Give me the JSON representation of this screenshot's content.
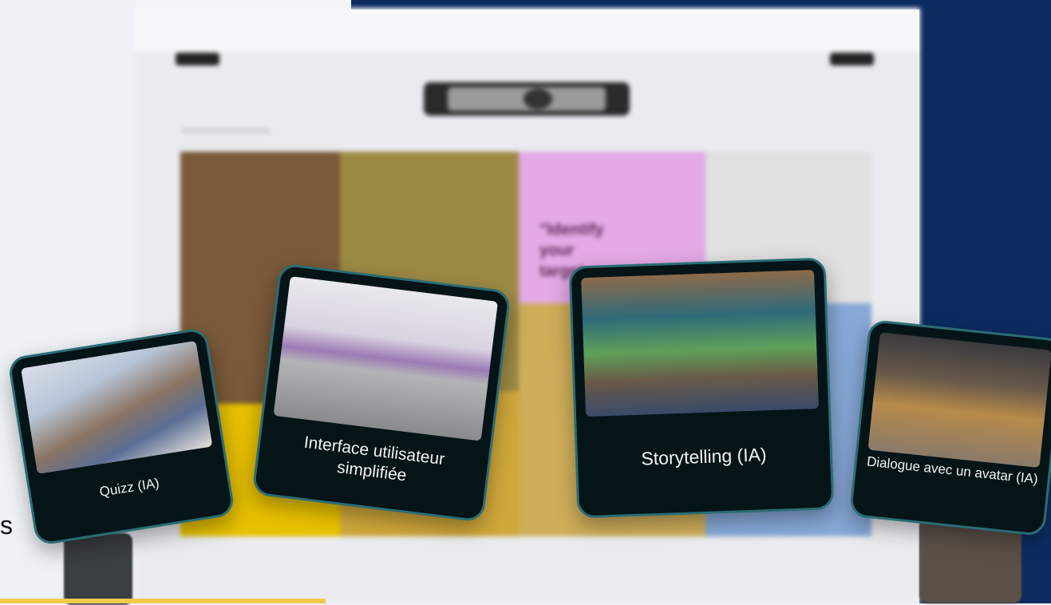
{
  "background": {
    "navy": "#0c2c61",
    "stray_letter": "s",
    "pink_quote": "\"Identify your target..."
  },
  "cards": [
    {
      "label": "Quizz (IA)"
    },
    {
      "label": "Interface utilisateur simplifiée"
    },
    {
      "label": "Storytelling (IA)"
    },
    {
      "label": "Dialogue avec un avatar (IA)"
    }
  ],
  "colors": {
    "card_bg": "#051417",
    "card_border": "#2a6d74"
  }
}
